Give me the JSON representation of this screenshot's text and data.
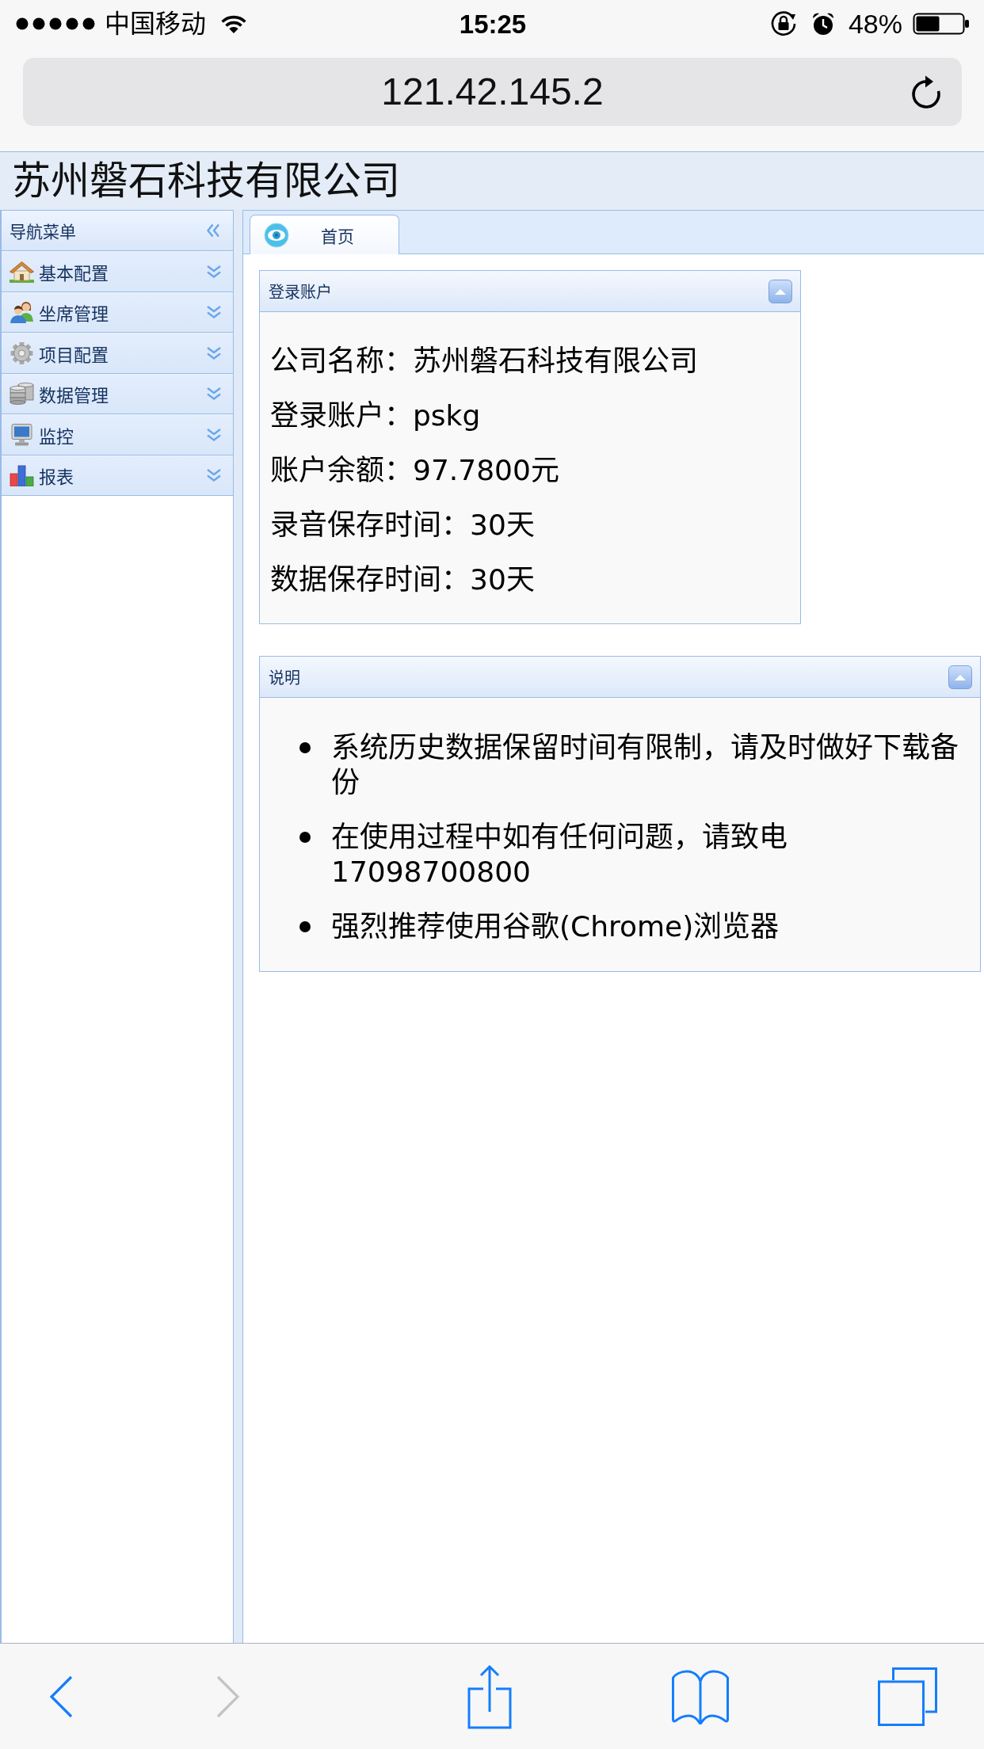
{
  "status_bar": {
    "carrier": "中国移动",
    "time": "15:25",
    "battery": "48%"
  },
  "address_bar": {
    "url": "121.42.145.2"
  },
  "header": {
    "title": "苏州磐石科技有限公司"
  },
  "sidebar": {
    "title": "导航菜单",
    "items": [
      {
        "label": "基本配置",
        "expanded": false
      },
      {
        "label": "坐席管理",
        "expanded": false
      },
      {
        "label": "项目配置",
        "expanded": false
      },
      {
        "label": "数据管理",
        "expanded": false
      },
      {
        "label": "监控",
        "expanded": false
      },
      {
        "label": "报表",
        "expanded": false
      }
    ]
  },
  "tabs": [
    {
      "label": "首页",
      "selected": true
    }
  ],
  "account_panel": {
    "title": "登录账户",
    "expanded": true,
    "fields": [
      {
        "label": "公司名称：",
        "value": "苏州磐石科技有限公司"
      },
      {
        "label": "登录账户：",
        "value": "pskg"
      },
      {
        "label": "账户余额：",
        "value": "97.7800元"
      },
      {
        "label": "录音保存时间：",
        "value": "30天"
      },
      {
        "label": "数据保存时间：",
        "value": "30天"
      }
    ]
  },
  "notes_panel": {
    "title": "说明",
    "expanded": true,
    "items": [
      "系统历史数据保留时间有限制，请及时做好下载备份",
      "在使用过程中如有任何问题，请致电17098700800",
      "强烈推荐使用谷歌(Chrome)浏览器"
    ]
  },
  "browser_toolbar": {
    "back": {
      "disabled": false
    },
    "forward": {
      "disabled": true
    }
  }
}
